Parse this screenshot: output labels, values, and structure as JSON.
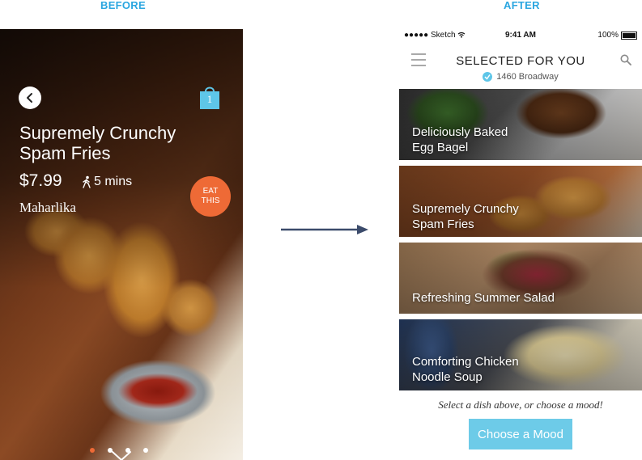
{
  "captions": {
    "before": "BEFORE",
    "after": "AFTER"
  },
  "before": {
    "cart_count": "1",
    "dish_title_line1": "Supremely Crunchy",
    "dish_title_line2": "Spam Fries",
    "price": "$7.99",
    "prep_time": "5 mins",
    "restaurant": "Maharlika",
    "eat_line1": "EAT",
    "eat_line2": "THIS",
    "carousel_pages": 4,
    "carousel_active_index": 0
  },
  "after": {
    "status": {
      "carrier": "●●●●● Sketch",
      "time": "9:41 AM",
      "battery": "100%"
    },
    "nav_title": "SELECTED FOR YOU",
    "location": "1460 Broadway",
    "dishes": [
      {
        "line1": "Deliciously Baked",
        "line2": "Egg Bagel"
      },
      {
        "line1": "Supremely Crunchy",
        "line2": "Spam Fries"
      },
      {
        "line1": "Refreshing Summer Salad",
        "line2": ""
      },
      {
        "line1": "Comforting Chicken",
        "line2": "Noodle Soup"
      }
    ],
    "prompt": "Select a dish above, or choose a mood!",
    "mood_button": "Choose a Mood"
  },
  "colors": {
    "accent_orange": "#ee6a36",
    "accent_blue": "#6dcbe8",
    "caption_blue": "#2aa6e0"
  },
  "icons": [
    "back-chevron-icon",
    "shopping-bag-icon",
    "walking-person-icon",
    "chevron-down-icon",
    "hamburger-menu-icon",
    "search-icon",
    "location-pin-icon",
    "wifi-icon",
    "battery-icon",
    "right-arrow-icon"
  ]
}
